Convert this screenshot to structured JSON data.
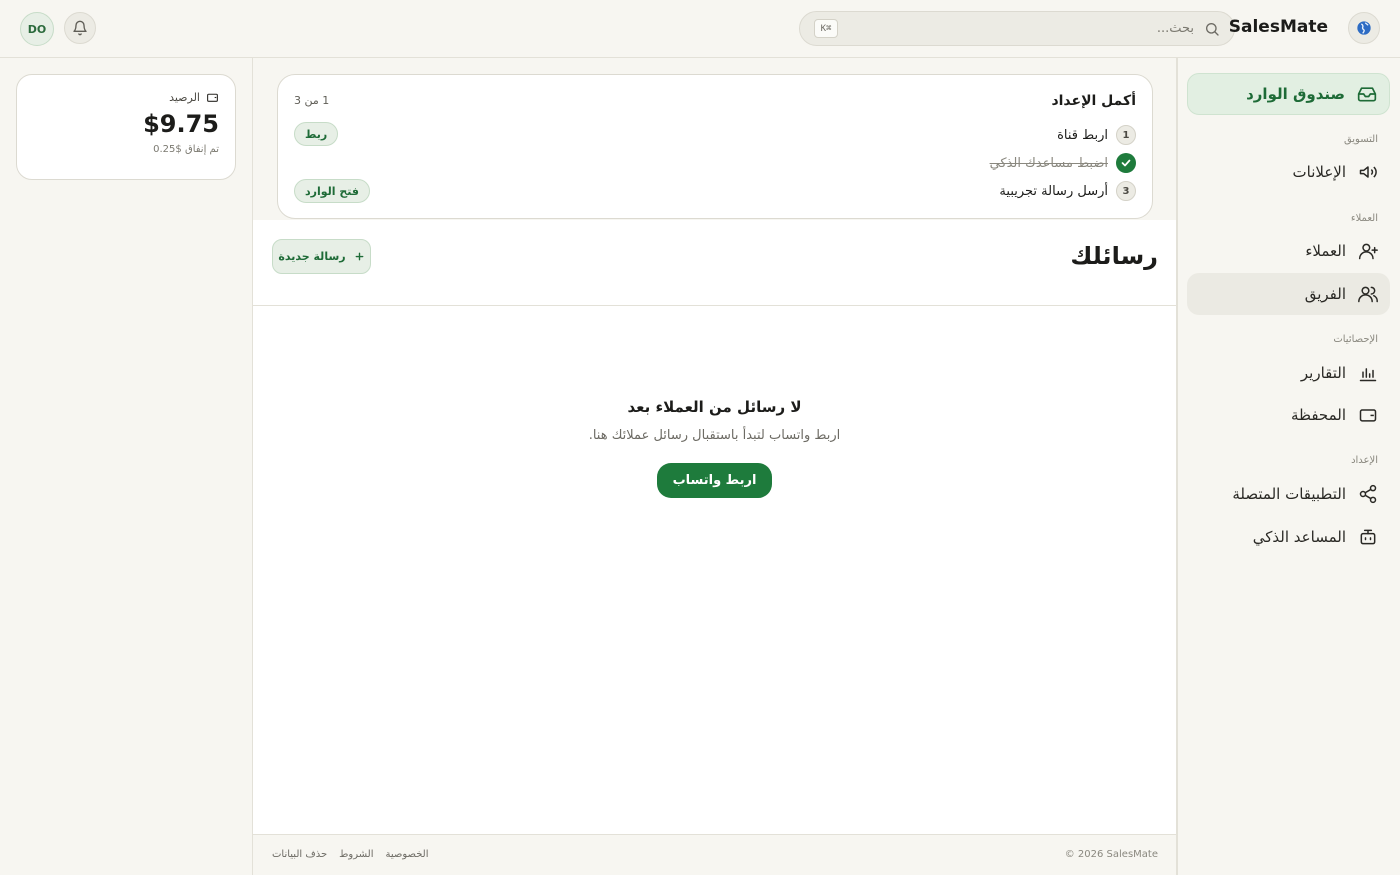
{
  "topbar": {
    "avatar_initials": "DO",
    "search_placeholder": "بحث...",
    "search_shortcut": "K⌘",
    "brand": "SalesMate"
  },
  "balance": {
    "label": "الرصيد",
    "amount": "$9.75",
    "spent": "تم إنفاق $0.25"
  },
  "sidebar": {
    "inbox": "صندوق الوارد",
    "sections": {
      "marketing": "التسويق",
      "customers": "العملاء",
      "stats": "الإحصائيات",
      "setup": "الإعداد"
    },
    "items": {
      "ads": "الإعلانات",
      "customers": "العملاء",
      "team": "الفريق",
      "reports": "التقارير",
      "wallet": "المحفظة",
      "connected_apps": "التطبيقات المتصلة",
      "ai_assistant": "المساعد الذكي"
    }
  },
  "setup": {
    "title": "أكمل الإعداد",
    "progress": "1 من 3",
    "steps": [
      {
        "num": "1",
        "label": "اربط قناة",
        "button": "ربط"
      },
      {
        "num": "",
        "label": "اضبط مساعدك الذكي",
        "done": true
      },
      {
        "num": "3",
        "label": "أرسل رسالة تجريبية",
        "button": "فتح الوارد"
      }
    ]
  },
  "messages": {
    "title": "رسائلك",
    "new_button": "رسالة جديدة",
    "empty_title": "لا رسائل من العملاء بعد",
    "empty_sub": "اربط واتساب لتبدأ باستقبال رسائل عملائك هنا.",
    "connect_button": "اربط واتساب"
  },
  "footer": {
    "copyright": "© 2026 SalesMate",
    "links": [
      "الخصوصية",
      "الشروط",
      "حذف البيانات"
    ]
  },
  "colors": {
    "accent": "#1e7b3c",
    "accent_soft": "#e7efe6",
    "background": "#f7f6f1"
  }
}
